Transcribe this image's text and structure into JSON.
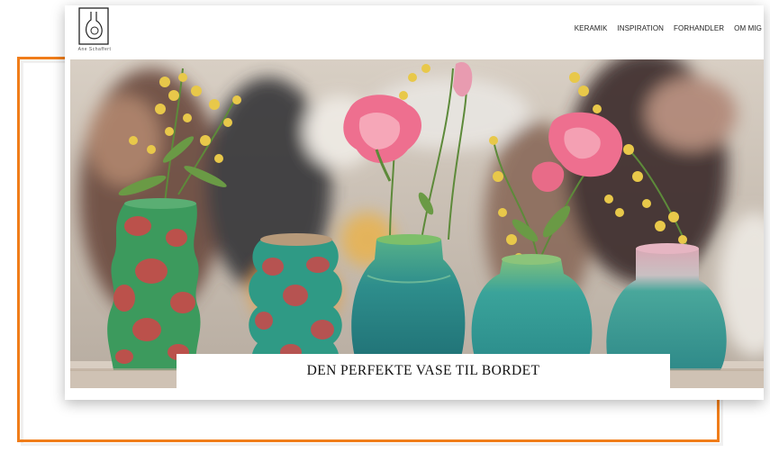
{
  "brand": {
    "name": "Ane Schaffert"
  },
  "nav": {
    "items": [
      {
        "label": "KERAMIK"
      },
      {
        "label": "INSPIRATION"
      },
      {
        "label": "FORHANDLER"
      },
      {
        "label": "OM MIG"
      }
    ]
  },
  "hero": {
    "caption": "DEN PERFEKTE VASE TIL BORDET"
  },
  "colors": {
    "accent_frame": "#f07d1a",
    "vase_teal": "#2f8f8a",
    "vase_green": "#3c9a5d",
    "vase_red": "#c94a4a",
    "flower_pink": "#ee6f8f",
    "mimosa_yellow": "#e8c84a"
  }
}
